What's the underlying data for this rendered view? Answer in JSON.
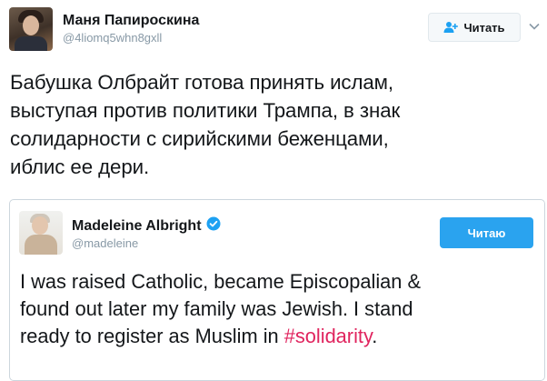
{
  "tweet": {
    "author_name": "Маня Папироскина",
    "author_handle": "@4liomq5whn8gxll",
    "follow_label": "Читать",
    "text_lines": [
      "Бабушка Олбрайт готова принять ислам,",
      "выступая против политики Трампа, в знак",
      "солидарности с сирийскими беженцами,",
      "иблис ее дери."
    ]
  },
  "quoted_tweet": {
    "author_name": "Madeleine Albright",
    "author_handle": "@madeleine",
    "verified": true,
    "following_label": "Читаю",
    "line1": "I was raised Catholic, became Episcopalian &",
    "line2": "found out later my family was Jewish. I stand",
    "line3_prefix": "ready to register as Muslim in ",
    "hashtag": "#solidarity",
    "line3_suffix": "."
  },
  "colors": {
    "link_hashtag": "#e0245e",
    "following_button": "#2aa3ef",
    "verified_badge": "#1da1f2"
  },
  "icons": [
    "add-user-icon",
    "chevron-down-icon",
    "verified-badge-icon"
  ]
}
